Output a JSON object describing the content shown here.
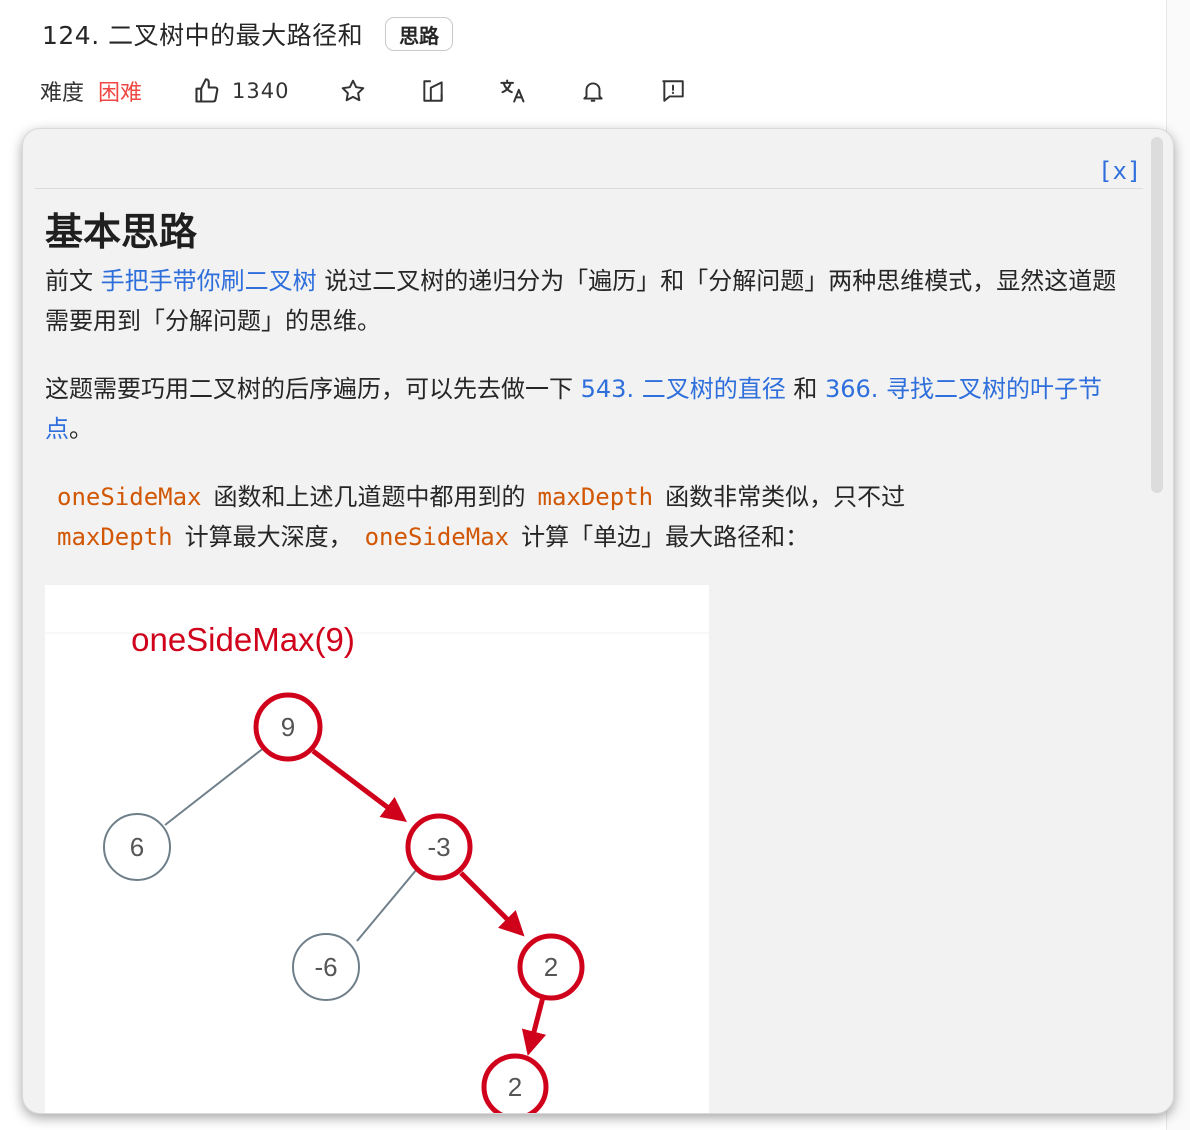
{
  "header": {
    "title": "124. 二叉树中的最大路径和",
    "tag_label": "思路"
  },
  "meta": {
    "difficulty_label": "难度",
    "difficulty_value": "困难",
    "likes": "1340",
    "icons": [
      "thumbs-up-icon",
      "star-icon",
      "share-icon",
      "translate-icon",
      "bell-icon",
      "feedback-icon"
    ]
  },
  "popover": {
    "close_label": "[x]",
    "heading": "基本思路",
    "p1": {
      "t1": "前文 ",
      "link1": "手把手带你刷二叉树",
      "t2": " 说过二叉树的递归分为「遍历」和「分解问题」两种思维模式，显然这道题需要用到「分解问题」的思维。"
    },
    "p2": {
      "t1": "这题需要巧用二叉树的后序遍历，可以先去做一下 ",
      "link1": "543. 二叉树的直径",
      "t2": " 和 ",
      "link2": "366. 寻找二叉树的叶子节点",
      "t3": "。"
    },
    "p3": {
      "code1": "oneSideMax",
      "t1": "函数和上述几道题中都用到的",
      "code2": "maxDepth",
      "t2": "函数非常类似，只不过",
      "code3": "maxDepth",
      "t3": "计算最大深度，",
      "code4": "oneSideMax",
      "t4": "计算「单边」最大路径和："
    },
    "figure": {
      "caption": "oneSideMax(9)",
      "nodes": [
        "9",
        "6",
        "-3",
        "-6",
        "2",
        "2"
      ]
    }
  },
  "colors": {
    "accent_link": "#2e6fdc",
    "difficulty_hard": "#ef4743",
    "code": "#d15704",
    "highlight": "#d0021b",
    "node_gray": "#6f7f8a"
  }
}
